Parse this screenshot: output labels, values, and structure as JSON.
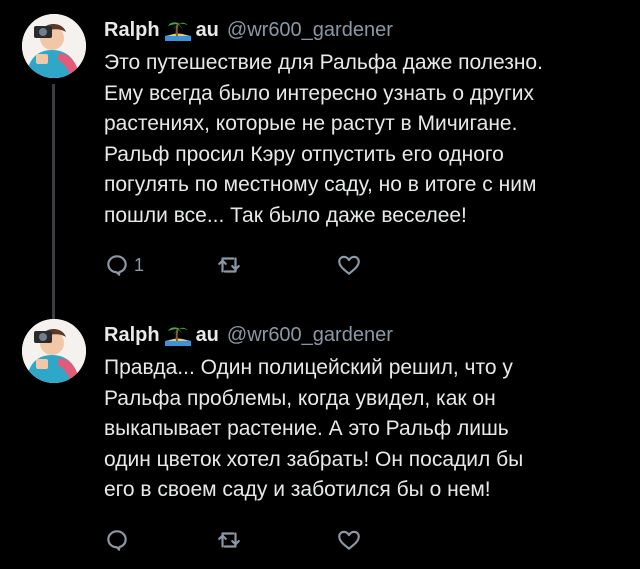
{
  "tweets": [
    {
      "author_name": "Ralph",
      "name_suffix": "au",
      "handle": "@wr600_gardener",
      "text": "Это путешествие для Ральфа даже полезно.\nЕму всегда было интересно узнать о других\nрастениях, которые не растут в Мичигане.\nРальф просил Кэру отпустить его одного\nпогулять по местному саду, но в итоге с ним\nпошли все... Так было даже веселее!",
      "reply_count": "1",
      "emoji": "island-emoji",
      "icons": [
        "reply-icon",
        "retweet-icon",
        "like-icon"
      ]
    },
    {
      "author_name": "Ralph",
      "name_suffix": "au",
      "handle": "@wr600_gardener",
      "text": "Правда... Один полицейский решил, что у\nРальфа проблемы, когда увидел, как он\nвыкапывает растение. А это Ральф лишь\nодин цветок хотел забрать! Он посадил бы\nего в своем саду и заботился бы о нем!",
      "reply_count": "",
      "emoji": "island-emoji",
      "icons": [
        "reply-icon",
        "retweet-icon",
        "like-icon"
      ]
    }
  ],
  "colors": {
    "background": "#000000",
    "text": "#e7e9ea",
    "secondary": "#8b98a5",
    "thread_line": "#3a3d41"
  }
}
